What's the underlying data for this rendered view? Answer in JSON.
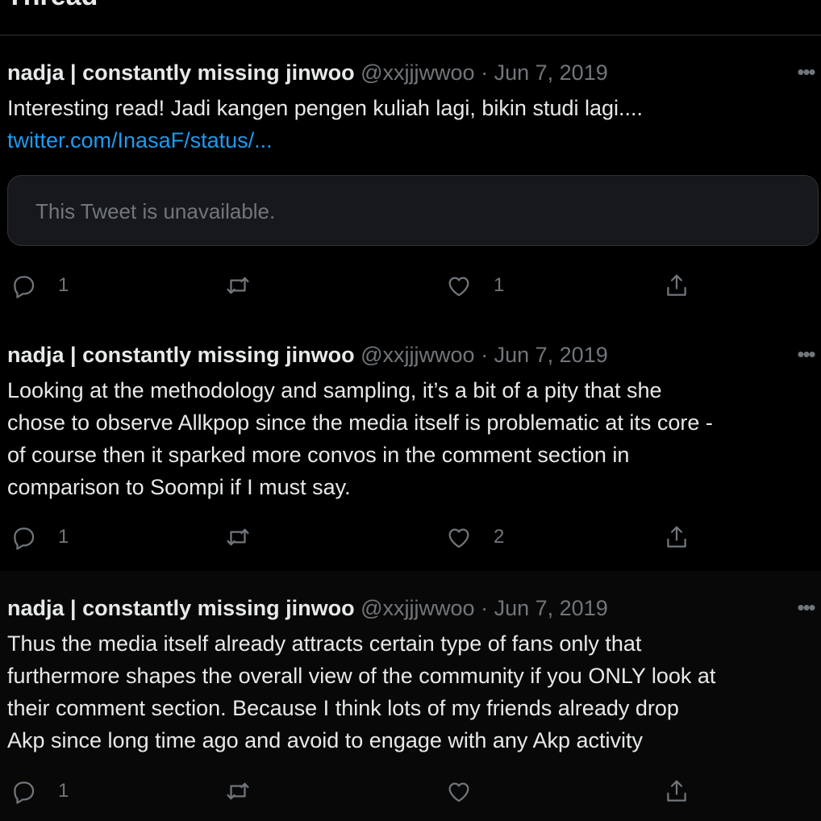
{
  "header": {
    "title": "Thread"
  },
  "tweets": [
    {
      "name": "nadja | constantly missing jinwoo",
      "handle": "@xxjjjwwoo",
      "separator": "·",
      "date": "Jun 7, 2019",
      "more": "•••",
      "lines": [
        "Interesting read! Jadi kangen pengen kuliah lagi, bikin studi lagi...."
      ],
      "link": "twitter.com/InasaF/status/...",
      "quote": "This Tweet is unavailable.",
      "reply_count": "1",
      "retweet_count": "",
      "like_count": "1"
    },
    {
      "name": "nadja | constantly missing jinwoo",
      "handle": "@xxjjjwwoo",
      "separator": "·",
      "date": "Jun 7, 2019",
      "more": "•••",
      "lines": [
        "Looking at the methodology and sampling, it’s a bit of a pity that she",
        "chose to observe Allkpop since the media itself is problematic at its core -",
        "of course then it sparked more convos in the comment section in",
        "comparison to Soompi if I must say."
      ],
      "reply_count": "1",
      "retweet_count": "",
      "like_count": "2"
    },
    {
      "name": "nadja | constantly missing jinwoo",
      "handle": "@xxjjjwwoo",
      "separator": "·",
      "date": "Jun 7, 2019",
      "more": "•••",
      "lines": [
        "Thus the media itself already attracts certain type of fans only that",
        "furthermore shapes the overall view of the community if you ONLY look at",
        "their comment section. Because I think lots of my friends already drop",
        "Akp since long time ago and avoid to engage with any Akp activity"
      ],
      "reply_count": "1",
      "retweet_count": "",
      "like_count": ""
    }
  ],
  "icons": {
    "reply": "reply-icon",
    "retweet": "retweet-icon",
    "like": "like-icon",
    "share": "share-icon",
    "more": "more-icon"
  },
  "colors": {
    "background": "#000000",
    "text": "#e7e9ea",
    "muted": "#71767b",
    "link": "#1d9bf0",
    "border": "#2f3336"
  }
}
